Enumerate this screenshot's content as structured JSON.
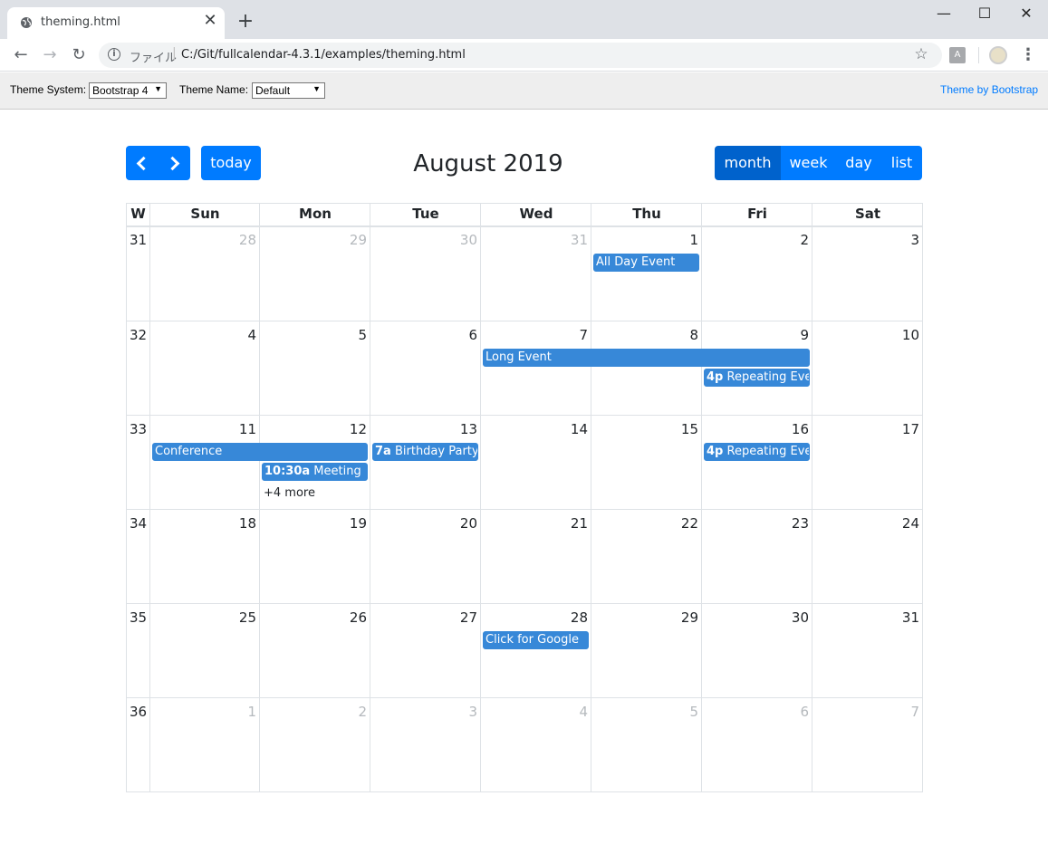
{
  "browser": {
    "tab_title": "theming.html",
    "url_scheme": "ファイル",
    "url": "C:/Git/fullcalendar-4.3.1/examples/theming.html"
  },
  "demo_toolbar": {
    "theme_system_label": "Theme System:",
    "theme_system_value": "Bootstrap 4",
    "theme_name_label": "Theme Name:",
    "theme_name_value": "Default",
    "theme_link": "Theme by Bootstrap"
  },
  "calendar": {
    "title": "August 2019",
    "today_label": "today",
    "views": [
      "month",
      "week",
      "day",
      "list"
    ],
    "active_view": "month",
    "week_header": "W",
    "day_headers": [
      "Sun",
      "Mon",
      "Tue",
      "Wed",
      "Thu",
      "Fri",
      "Sat"
    ],
    "weeks": [
      {
        "num": "31",
        "days": [
          "28",
          "29",
          "30",
          "31",
          "1",
          "2",
          "3"
        ]
      },
      {
        "num": "32",
        "days": [
          "4",
          "5",
          "6",
          "7",
          "8",
          "9",
          "10"
        ]
      },
      {
        "num": "33",
        "days": [
          "11",
          "12",
          "13",
          "14",
          "15",
          "16",
          "17"
        ]
      },
      {
        "num": "34",
        "days": [
          "18",
          "19",
          "20",
          "21",
          "22",
          "23",
          "24"
        ]
      },
      {
        "num": "35",
        "days": [
          "25",
          "26",
          "27",
          "28",
          "29",
          "30",
          "31"
        ]
      },
      {
        "num": "36",
        "days": [
          "1",
          "2",
          "3",
          "4",
          "5",
          "6",
          "7"
        ]
      }
    ],
    "events": {
      "all_day": {
        "title": "All Day Event"
      },
      "long": {
        "title": "Long Event"
      },
      "repeat1": {
        "time": "4p",
        "title": "Repeating Even"
      },
      "conference": {
        "title": "Conference"
      },
      "meeting": {
        "time": "10:30a",
        "title": "Meeting"
      },
      "birthday": {
        "time": "7a",
        "title": "Birthday Party"
      },
      "repeat2": {
        "time": "4p",
        "title": "Repeating Even"
      },
      "google": {
        "title": "Click for Google"
      }
    },
    "more_link": "+4 more"
  },
  "colors": {
    "primary": "#007bff",
    "active": "#0062cc",
    "event": "#3788d8"
  }
}
